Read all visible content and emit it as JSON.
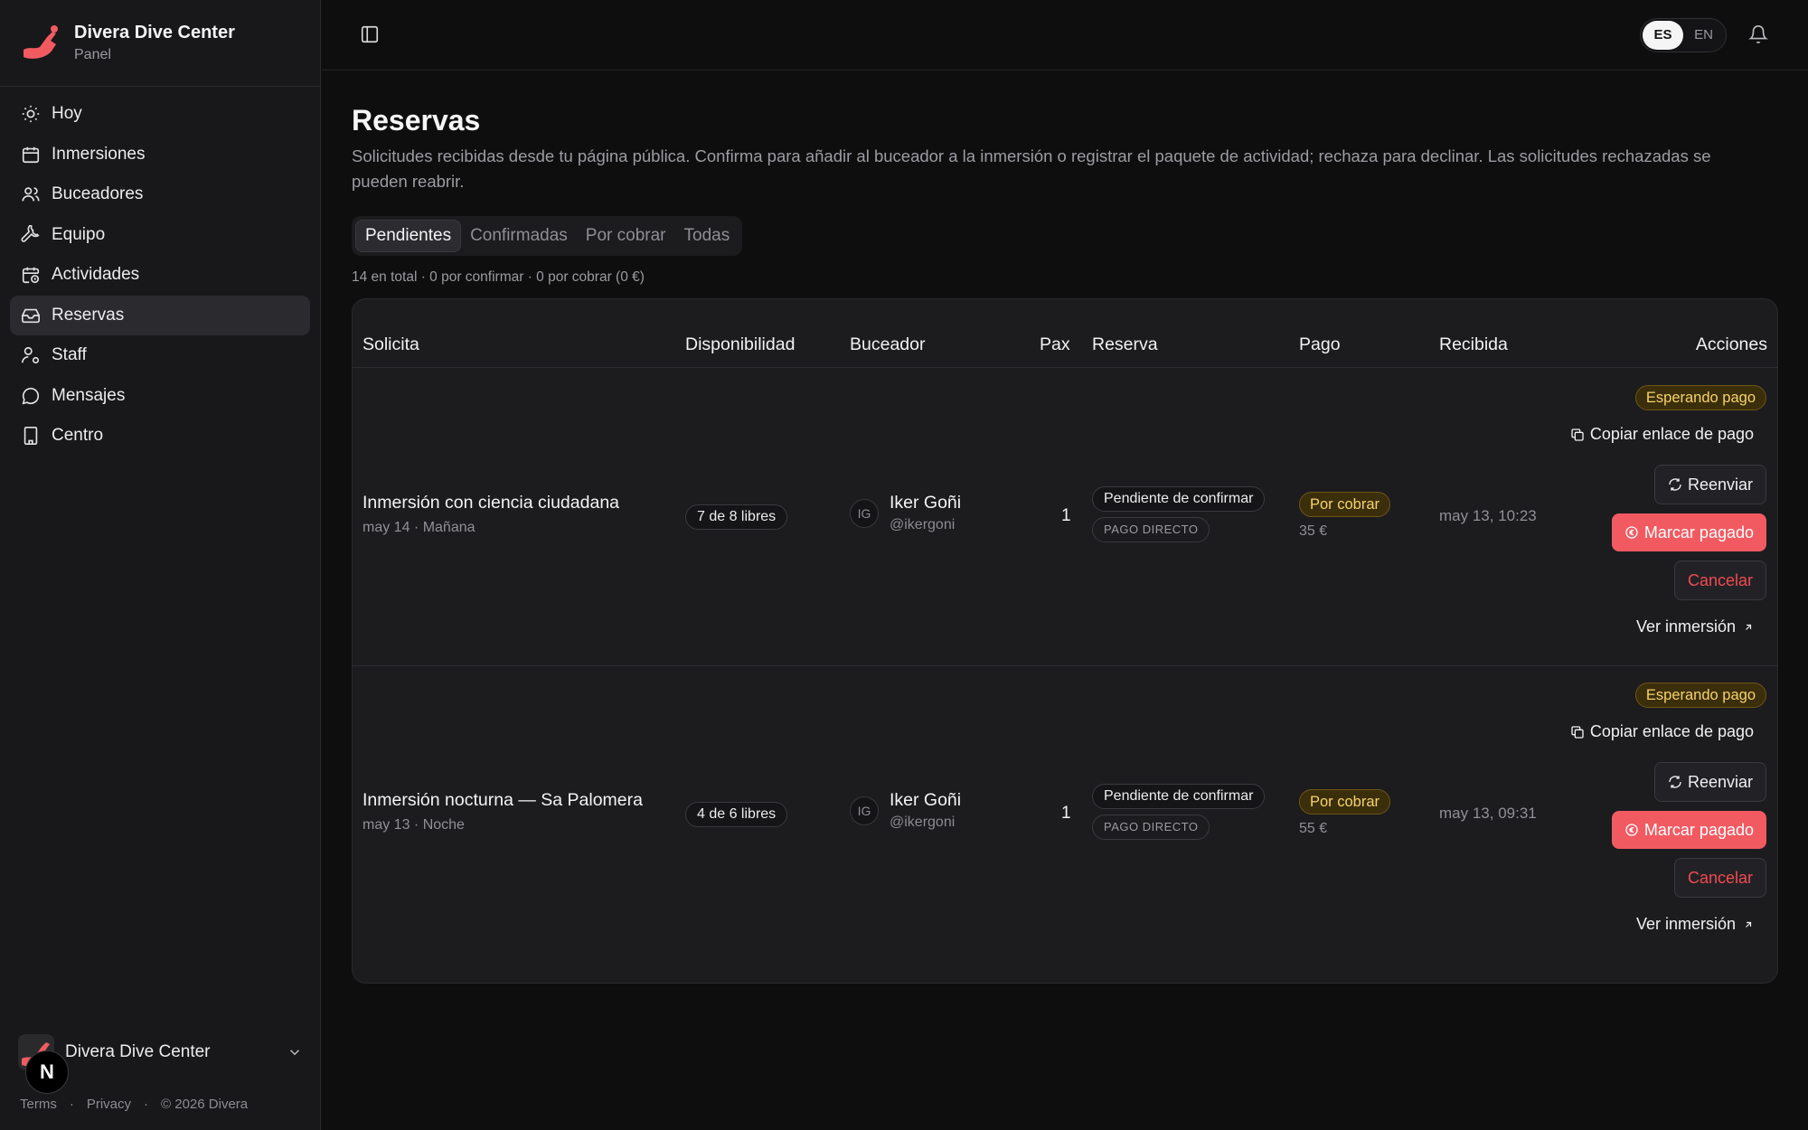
{
  "brand": {
    "name": "Divera Dive Center",
    "subtitle": "Panel"
  },
  "nav": [
    {
      "label": "Hoy",
      "icon": "sun-icon"
    },
    {
      "label": "Inmersiones",
      "icon": "calendar-icon"
    },
    {
      "label": "Buceadores",
      "icon": "users-icon"
    },
    {
      "label": "Equipo",
      "icon": "wrench-icon"
    },
    {
      "label": "Actividades",
      "icon": "calendar-clock-icon"
    },
    {
      "label": "Reservas",
      "icon": "inbox-icon",
      "active": true
    },
    {
      "label": "Staff",
      "icon": "user-cog-icon"
    },
    {
      "label": "Mensajes",
      "icon": "message-icon"
    },
    {
      "label": "Centro",
      "icon": "building-icon"
    }
  ],
  "footer": {
    "account": "Divera Dive Center",
    "links": [
      "Terms",
      "·",
      "Privacy",
      "·",
      "© 2026 Divera"
    ],
    "badge": "N"
  },
  "lang": {
    "es": "ES",
    "en": "EN"
  },
  "page": {
    "title": "Reservas",
    "description": "Solicitudes recibidas desde tu página pública. Confirma para añadir al buceador a la inmersión o registrar el paquete de actividad; rechaza para declinar. Las solicitudes rechazadas se pueden reabrir.",
    "tabs": [
      "Pendientes",
      "Confirmadas",
      "Por cobrar",
      "Todas"
    ],
    "summary": "14 en total · 0 por confirmar · 0 por cobrar (0 €)"
  },
  "table": {
    "headers": {
      "solicita": "Solicita",
      "disponibilidad": "Disponibilidad",
      "buceador": "Buceador",
      "pax": "Pax",
      "reserva": "Reserva",
      "pago": "Pago",
      "recibida": "Recibida",
      "acciones": "Acciones"
    },
    "rows": [
      {
        "title": "Inmersión con ciencia ciudadana",
        "sub": "may 14 · Mañana",
        "availability": "7 de 8 libres",
        "avatar": "IG",
        "diver": "Iker Goñi",
        "handle": "@ikergoni",
        "pax": "1",
        "status": "Pendiente de confirmar",
        "method": "PAGO DIRECTO",
        "payment": "Por cobrar",
        "amount": "35 €",
        "received": "may 13, 10:23",
        "badge": "Esperando pago",
        "copy": "Copiar enlace de pago",
        "resend": "Reenviar",
        "mark_paid": "Marcar pagado",
        "cancel": "Cancelar",
        "view": "Ver inmersión"
      },
      {
        "title": "Inmersión nocturna — Sa Palomera",
        "sub": "may 13 · Noche",
        "availability": "4 de 6 libres",
        "avatar": "IG",
        "diver": "Iker Goñi",
        "handle": "@ikergoni",
        "pax": "1",
        "status": "Pendiente de confirmar",
        "method": "PAGO DIRECTO",
        "payment": "Por cobrar",
        "amount": "55 €",
        "received": "may 13, 09:31",
        "badge": "Esperando pago",
        "copy": "Copiar enlace de pago",
        "resend": "Reenviar",
        "mark_paid": "Marcar pagado",
        "cancel": "Cancelar",
        "view": "Ver inmersión"
      }
    ]
  },
  "colors": {
    "accent": "#f25a61",
    "amber": "#f6d36a"
  }
}
